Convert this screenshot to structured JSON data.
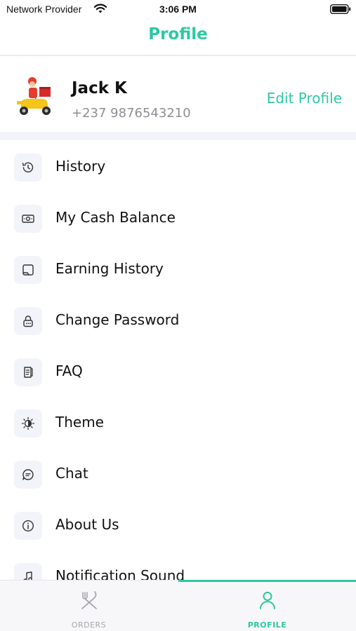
{
  "status_bar": {
    "carrier": "Network Provider",
    "time": "3:06 PM",
    "wifi_icon": "wifi-icon",
    "battery_icon": "battery-icon"
  },
  "nav": {
    "title": "Profile"
  },
  "profile": {
    "name": "Jack K",
    "phone": "+237 9876543210",
    "edit_label": "Edit Profile",
    "avatar_icon": "delivery-scooter-avatar"
  },
  "menu": {
    "items": [
      {
        "label": "History",
        "icon": "history-icon"
      },
      {
        "label": "My Cash Balance",
        "icon": "cash-icon"
      },
      {
        "label": "Earning History",
        "icon": "earning-icon"
      },
      {
        "label": "Change Password",
        "icon": "lock-icon"
      },
      {
        "label": "FAQ",
        "icon": "document-icon"
      },
      {
        "label": "Theme",
        "icon": "theme-icon"
      },
      {
        "label": "Chat",
        "icon": "chat-icon"
      },
      {
        "label": "About Us",
        "icon": "info-icon"
      },
      {
        "label": "Notification Sound",
        "icon": "music-icon"
      }
    ]
  },
  "tabs": {
    "items": [
      {
        "label": "ORDERS",
        "icon": "fork-knife-icon",
        "active": false
      },
      {
        "label": "PROFILE",
        "icon": "person-icon",
        "active": true
      }
    ]
  },
  "colors": {
    "accent": "#2cc9a1",
    "icon_bg": "#f3f4fa",
    "secondary_text": "#8e8e93"
  }
}
